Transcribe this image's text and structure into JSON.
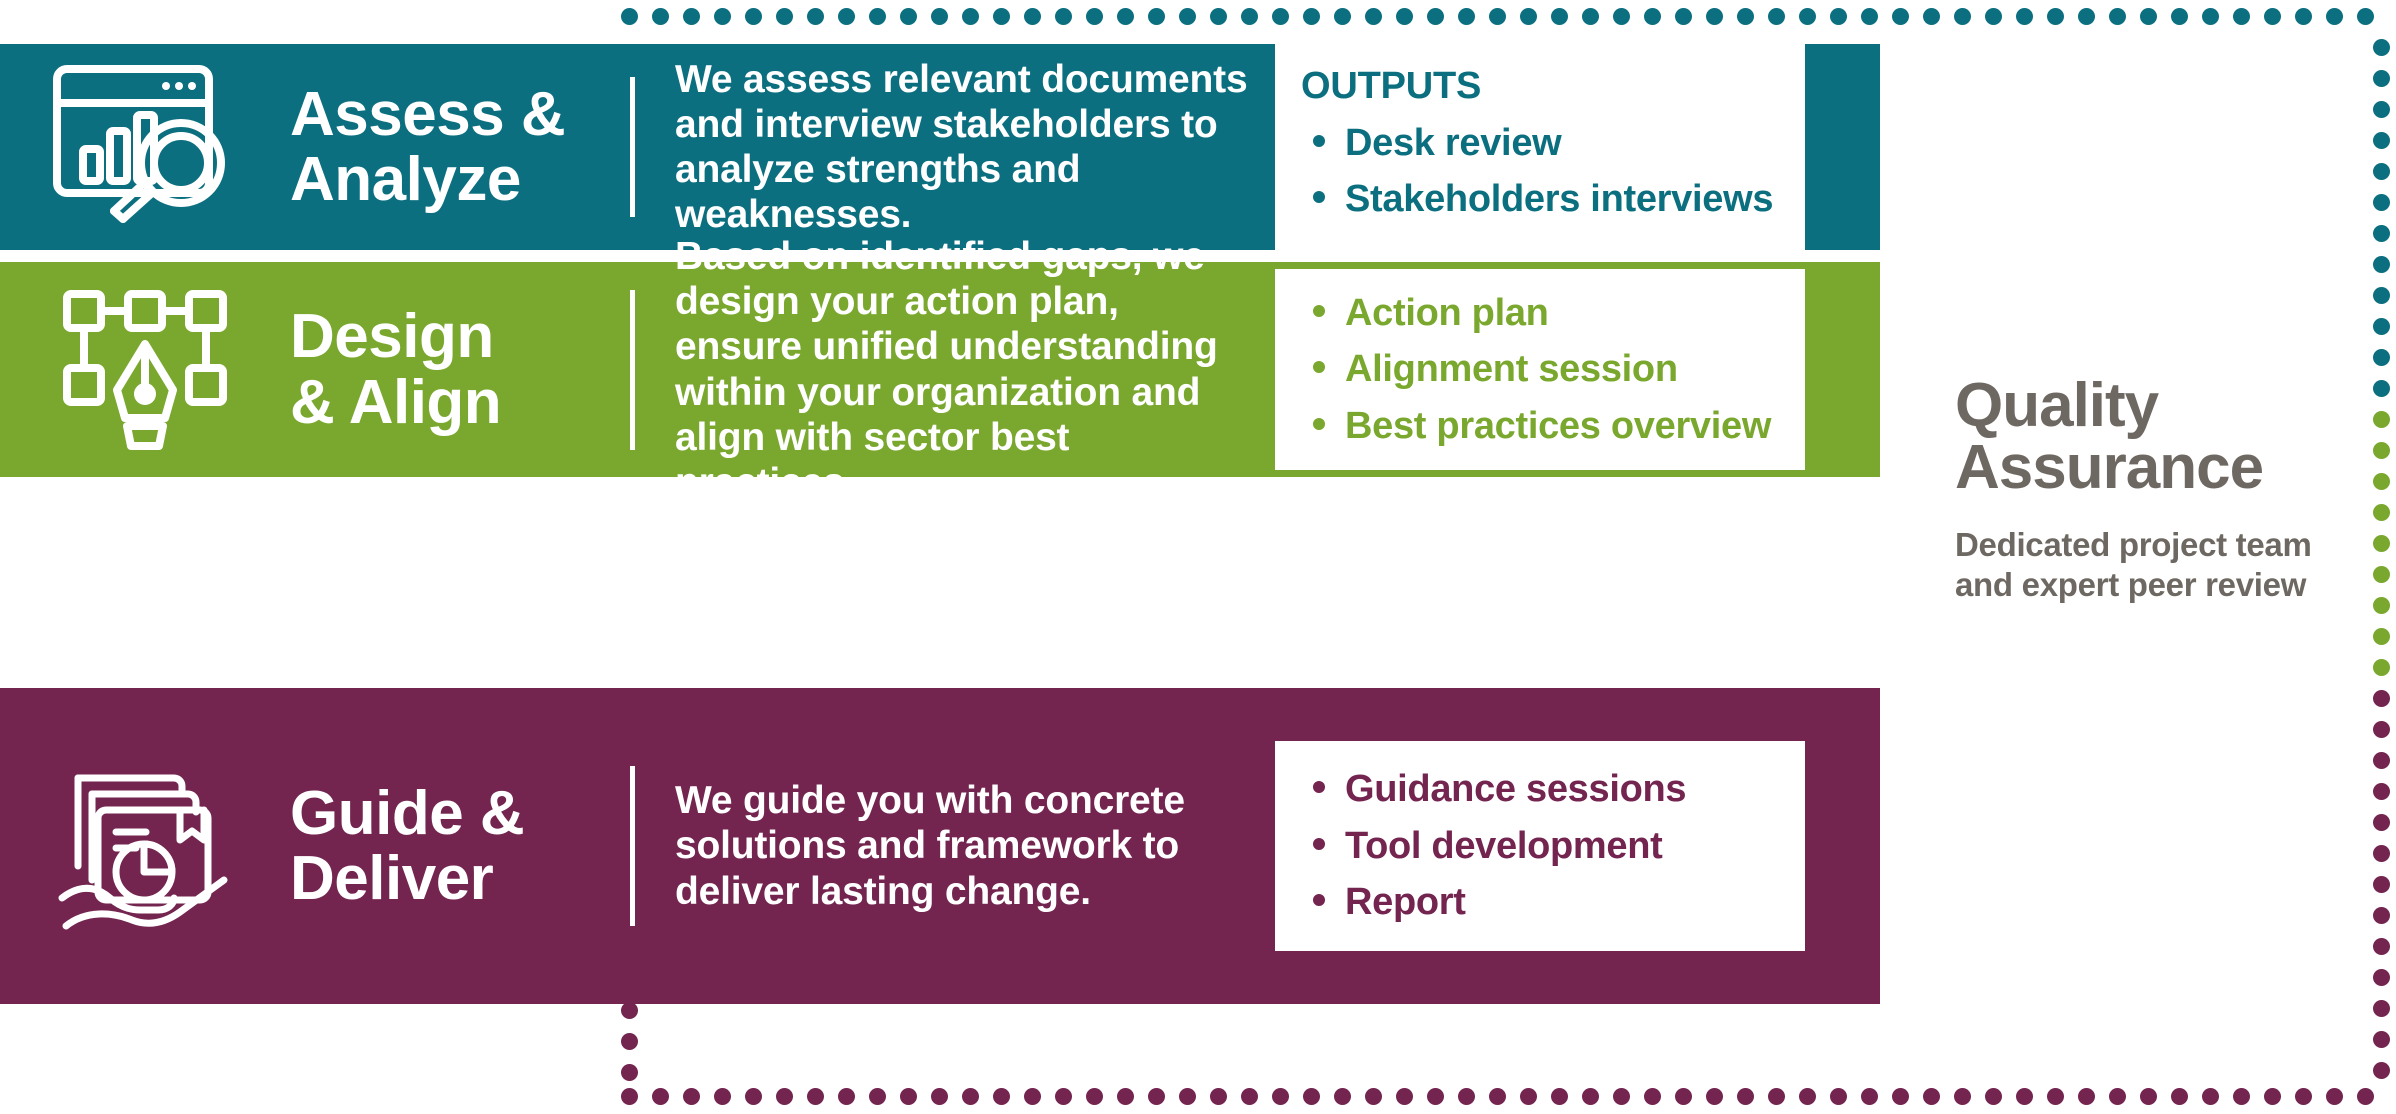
{
  "colors": {
    "teal": "#0b6f80",
    "green": "#7aa82e",
    "purple": "#73244f",
    "qa_gray": "#6e6862",
    "white": "#ffffff"
  },
  "rows": [
    {
      "id": "assess-analyze",
      "icon": "dashboard-magnifier-icon",
      "title_line1": "Assess &",
      "title_line2": "Analyze",
      "description": "We assess relevant documents and interview stakeholders to analyze strengths and weaknesses.",
      "outputs_heading": "OUTPUTS",
      "outputs": [
        "Desk review",
        "Stakeholders interviews"
      ],
      "color": "#0b6f80"
    },
    {
      "id": "design-align",
      "icon": "pen-nib-nodes-icon",
      "title_line1": "Design",
      "title_line2": "& Align",
      "description": "Based on identified gaps, we design your action plan, ensure unified understanding within your organization and align with sector best practices.",
      "outputs_heading": "",
      "outputs": [
        "Action plan",
        "Alignment session",
        "Best practices overview"
      ],
      "color": "#7aa82e"
    },
    {
      "id": "guide-deliver",
      "icon": "hand-holding-report-icon",
      "title_line1": "Guide &",
      "title_line2": "Deliver",
      "description": "We guide you with concrete solutions and framework to deliver lasting change.",
      "outputs_heading": "",
      "outputs": [
        "Guidance sessions",
        "Tool development",
        "Report"
      ],
      "color": "#73244f"
    }
  ],
  "quality_assurance": {
    "title_line1": "Quality",
    "title_line2": "Assurance",
    "subtitle": "Dedicated project team and expert peer review"
  }
}
